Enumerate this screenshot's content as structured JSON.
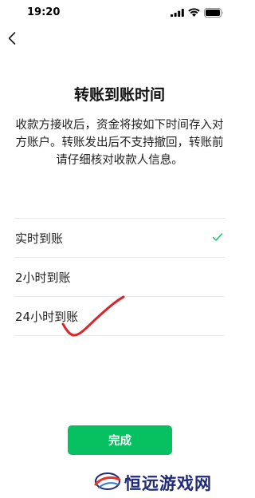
{
  "status_bar": {
    "time": "19:20",
    "icons": [
      "signal-icon",
      "wifi-icon",
      "battery-icon"
    ]
  },
  "nav": {
    "back_icon": "chevron-left-icon"
  },
  "title": "转账到账时间",
  "description": "收款方接收后，资金将按如下时间存入对方账户。转账发出后不支持撤回，转账前请仔细核对收款人信息。",
  "options": [
    {
      "label": "实时到账",
      "selected": true
    },
    {
      "label": "2小时到账",
      "selected": false
    },
    {
      "label": "24小时到账",
      "selected": false
    }
  ],
  "done_button_label": "完成",
  "watermark": {
    "text": "恒远游戏网"
  },
  "colors": {
    "accent": "#07c160",
    "annotation": "#d9252b",
    "watermark_text": "#1e2a78",
    "divider": "#e9e9e9"
  }
}
